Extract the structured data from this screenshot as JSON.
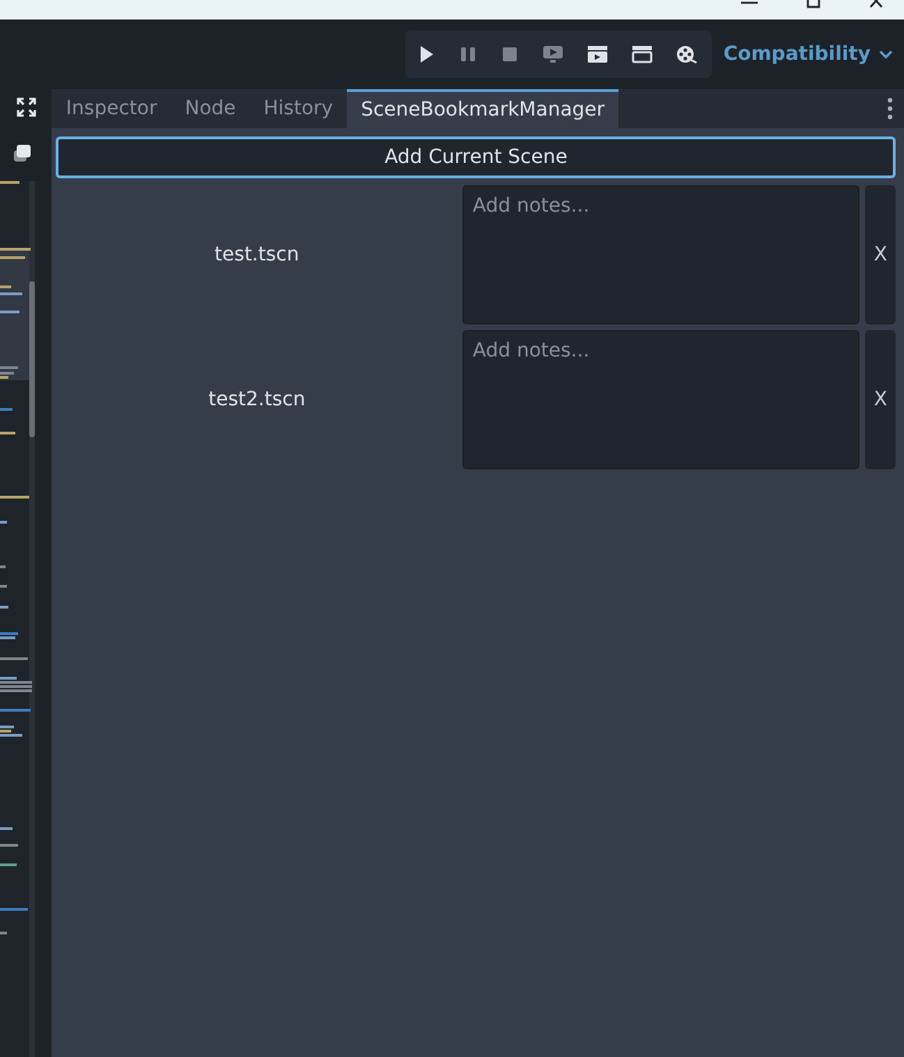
{
  "renderer": {
    "label": "Compatibility"
  },
  "tabs": [
    {
      "label": "Inspector",
      "selected": false
    },
    {
      "label": "Node",
      "selected": false
    },
    {
      "label": "History",
      "selected": false
    },
    {
      "label": "SceneBookmarkManager",
      "selected": true
    }
  ],
  "add_button": {
    "label": "Add Current Scene"
  },
  "bookmarks": [
    {
      "name": "test.tscn",
      "notes": {
        "placeholder": "Add notes..."
      },
      "remove_button": "X"
    },
    {
      "name": "test2.tscn",
      "notes": {
        "placeholder": "Add notes..."
      },
      "remove_button": "X"
    }
  ]
}
